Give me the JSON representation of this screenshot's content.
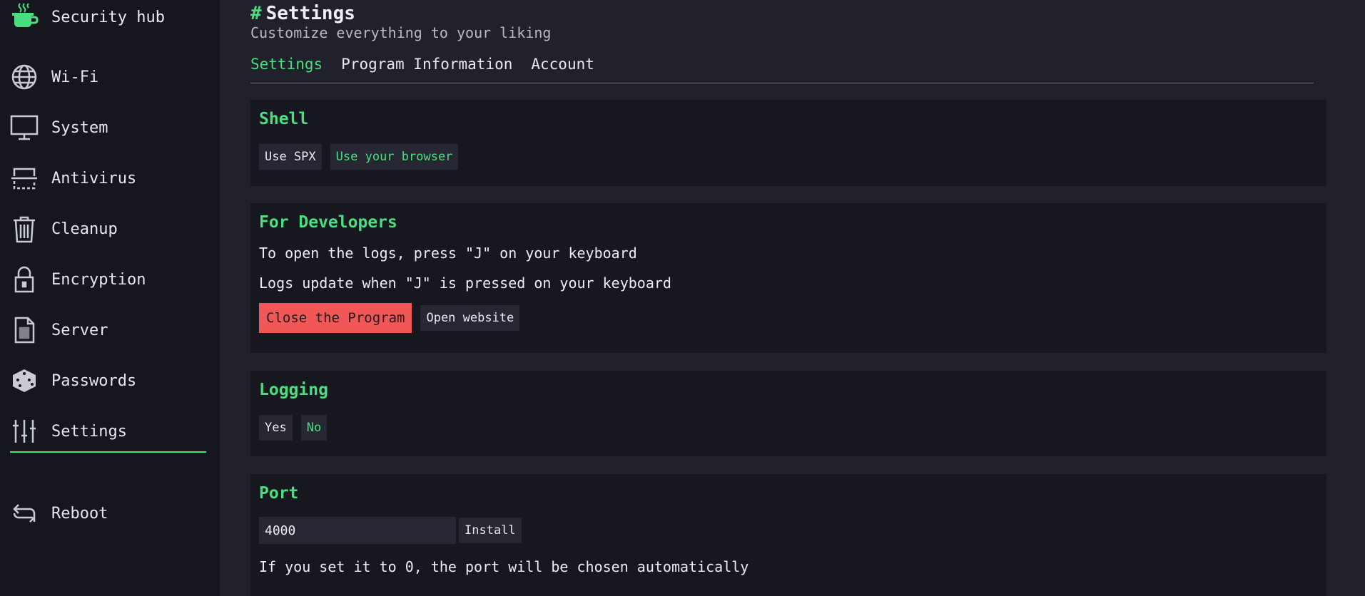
{
  "app": {
    "brand": "Security hub"
  },
  "sidebar": {
    "items": [
      {
        "label": "Wi-Fi",
        "icon": "globe-icon"
      },
      {
        "label": "System",
        "icon": "monitor-icon"
      },
      {
        "label": "Antivirus",
        "icon": "scanner-icon"
      },
      {
        "label": "Cleanup",
        "icon": "trash-icon"
      },
      {
        "label": "Encryption",
        "icon": "lock-icon"
      },
      {
        "label": "Server",
        "icon": "file-icon"
      },
      {
        "label": "Passwords",
        "icon": "dice-icon"
      },
      {
        "label": "Settings",
        "icon": "sliders-icon"
      },
      {
        "label": "Reboot",
        "icon": "reboot-icon"
      }
    ],
    "active": "Settings"
  },
  "header": {
    "hash": "#",
    "title": "Settings",
    "subtitle": "Customize everything to your liking"
  },
  "tabs": [
    {
      "label": "Settings"
    },
    {
      "label": "Program Information"
    },
    {
      "label": "Account"
    }
  ],
  "shell": {
    "title": "Shell",
    "options": [
      "Use SPX",
      "Use your browser"
    ],
    "selected": "Use your browser"
  },
  "developers": {
    "title": "For Developers",
    "line1": "To open the logs, press \"J\" on your keyboard",
    "line2": "Logs update when \"J\" is pressed on your keyboard",
    "close_label": "Close the Program",
    "website_label": "Open website"
  },
  "logging": {
    "title": "Logging",
    "options": [
      "Yes",
      "No"
    ],
    "selected": "No"
  },
  "port": {
    "title": "Port",
    "value": "4000",
    "install_label": "Install",
    "note": "If you set it to 0, the port will be chosen automatically"
  },
  "colors": {
    "accent": "#4ade80",
    "danger": "#f25757",
    "sidebar_bg": "#16171e",
    "main_bg": "#20212b",
    "card_bg": "#17181f"
  }
}
